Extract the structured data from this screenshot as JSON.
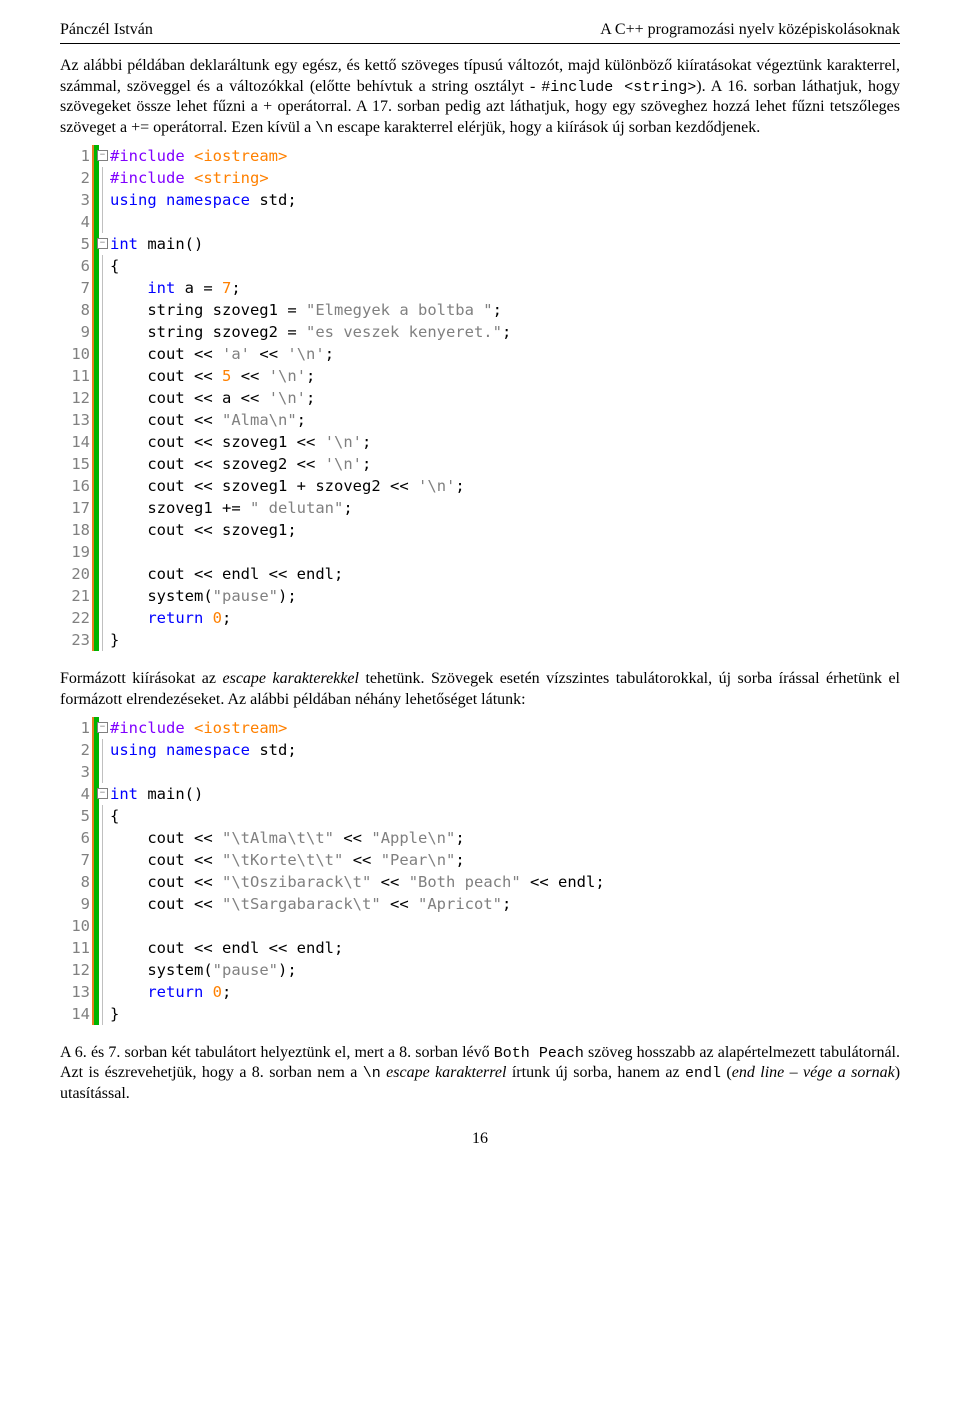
{
  "header": {
    "left": "Pánczél István",
    "right": "A C++ programozási nyelv középiskolásoknak"
  },
  "para1_pre": "Az alábbi példában deklaráltunk egy egész, és kettő szöveges típusú változót, majd különböző kiíratásokat végeztünk karakterrel, számmal, szöveggel és a változókkal (előtte behívtuk a string osztályt - ",
  "para1_code": "#include <string>",
  "para1_post": "). A 16. sorban láthatjuk, hogy szövegeket össze lehet fűzni a + operátorral. A 17. sorban pedig azt láthatjuk, hogy egy szöveghez hozzá lehet fűzni tetszőleges szöveget a += operátorral. Ezen kívül a ",
  "para1_esc": "\\n",
  "para1_end": " escape karakterrel elérjük, hogy a kiírások új sorban kezdődjenek.",
  "code1": [
    {
      "n": "1",
      "fold": "-",
      "og": true,
      "grey": false,
      "parts": [
        [
          "purple",
          "#include "
        ],
        [
          "orange",
          "<iostream>"
        ]
      ]
    },
    {
      "n": "2",
      "fold": "",
      "og": true,
      "grey": true,
      "parts": [
        [
          "purple",
          "#include "
        ],
        [
          "orange",
          "<string>"
        ]
      ]
    },
    {
      "n": "3",
      "fold": "",
      "og": true,
      "grey": true,
      "parts": [
        [
          "blue",
          "using namespace"
        ],
        [
          "black",
          " std"
        ],
        [
          "black",
          ";"
        ]
      ]
    },
    {
      "n": "4",
      "fold": "",
      "og": true,
      "grey": true,
      "parts": [
        [
          "black",
          ""
        ]
      ]
    },
    {
      "n": "5",
      "fold": "-",
      "og": true,
      "grey": false,
      "parts": [
        [
          "blue",
          "int"
        ],
        [
          "black",
          " main"
        ],
        [
          "black",
          "()"
        ]
      ]
    },
    {
      "n": "6",
      "fold": "",
      "og": true,
      "grey": true,
      "parts": [
        [
          "black",
          "{"
        ]
      ]
    },
    {
      "n": "7",
      "fold": "",
      "og": true,
      "grey": true,
      "parts": [
        [
          "black",
          "    "
        ],
        [
          "blue",
          "int"
        ],
        [
          "black",
          " a "
        ],
        [
          "black",
          "="
        ],
        [
          "black",
          " "
        ],
        [
          "orange",
          "7"
        ],
        [
          "black",
          ";"
        ]
      ]
    },
    {
      "n": "8",
      "fold": "",
      "og": true,
      "grey": true,
      "parts": [
        [
          "black",
          "    string szoveg1 "
        ],
        [
          "black",
          "="
        ],
        [
          "black",
          " "
        ],
        [
          "grey",
          "\"Elmegyek a boltba \""
        ],
        [
          "black",
          ";"
        ]
      ]
    },
    {
      "n": "9",
      "fold": "",
      "og": true,
      "grey": true,
      "parts": [
        [
          "black",
          "    string szoveg2 "
        ],
        [
          "black",
          "="
        ],
        [
          "black",
          " "
        ],
        [
          "grey",
          "\"es veszek kenyeret.\""
        ],
        [
          "black",
          ";"
        ]
      ]
    },
    {
      "n": "10",
      "fold": "",
      "og": true,
      "grey": true,
      "parts": [
        [
          "black",
          "    cout "
        ],
        [
          "black",
          "<<"
        ],
        [
          "black",
          " "
        ],
        [
          "grey",
          "'a'"
        ],
        [
          "black",
          " "
        ],
        [
          "black",
          "<<"
        ],
        [
          "black",
          " "
        ],
        [
          "grey",
          "'\\n'"
        ],
        [
          "black",
          ";"
        ]
      ]
    },
    {
      "n": "11",
      "fold": "",
      "og": true,
      "grey": true,
      "parts": [
        [
          "black",
          "    cout "
        ],
        [
          "black",
          "<<"
        ],
        [
          "black",
          " "
        ],
        [
          "orange",
          "5"
        ],
        [
          "black",
          " "
        ],
        [
          "black",
          "<<"
        ],
        [
          "black",
          " "
        ],
        [
          "grey",
          "'\\n'"
        ],
        [
          "black",
          ";"
        ]
      ]
    },
    {
      "n": "12",
      "fold": "",
      "og": true,
      "grey": true,
      "parts": [
        [
          "black",
          "    cout "
        ],
        [
          "black",
          "<<"
        ],
        [
          "black",
          " a "
        ],
        [
          "black",
          "<<"
        ],
        [
          "black",
          " "
        ],
        [
          "grey",
          "'\\n'"
        ],
        [
          "black",
          ";"
        ]
      ]
    },
    {
      "n": "13",
      "fold": "",
      "og": true,
      "grey": true,
      "parts": [
        [
          "black",
          "    cout "
        ],
        [
          "black",
          "<<"
        ],
        [
          "black",
          " "
        ],
        [
          "grey",
          "\"Alma\\n\""
        ],
        [
          "black",
          ";"
        ]
      ]
    },
    {
      "n": "14",
      "fold": "",
      "og": true,
      "grey": true,
      "parts": [
        [
          "black",
          "    cout "
        ],
        [
          "black",
          "<<"
        ],
        [
          "black",
          " szoveg1 "
        ],
        [
          "black",
          "<<"
        ],
        [
          "black",
          " "
        ],
        [
          "grey",
          "'\\n'"
        ],
        [
          "black",
          ";"
        ]
      ]
    },
    {
      "n": "15",
      "fold": "",
      "og": true,
      "grey": true,
      "parts": [
        [
          "black",
          "    cout "
        ],
        [
          "black",
          "<<"
        ],
        [
          "black",
          " szoveg2 "
        ],
        [
          "black",
          "<<"
        ],
        [
          "black",
          " "
        ],
        [
          "grey",
          "'\\n'"
        ],
        [
          "black",
          ";"
        ]
      ]
    },
    {
      "n": "16",
      "fold": "",
      "og": true,
      "grey": true,
      "parts": [
        [
          "black",
          "    cout "
        ],
        [
          "black",
          "<<"
        ],
        [
          "black",
          " szoveg1 "
        ],
        [
          "black",
          "+"
        ],
        [
          "black",
          " szoveg2 "
        ],
        [
          "black",
          "<<"
        ],
        [
          "black",
          " "
        ],
        [
          "grey",
          "'\\n'"
        ],
        [
          "black",
          ";"
        ]
      ]
    },
    {
      "n": "17",
      "fold": "",
      "og": true,
      "grey": true,
      "parts": [
        [
          "black",
          "    szoveg1 "
        ],
        [
          "black",
          "+="
        ],
        [
          "black",
          " "
        ],
        [
          "grey",
          "\" delutan\""
        ],
        [
          "black",
          ";"
        ]
      ]
    },
    {
      "n": "18",
      "fold": "",
      "og": true,
      "grey": true,
      "parts": [
        [
          "black",
          "    cout "
        ],
        [
          "black",
          "<<"
        ],
        [
          "black",
          " szoveg1"
        ],
        [
          "black",
          ";"
        ]
      ]
    },
    {
      "n": "19",
      "fold": "",
      "og": true,
      "grey": true,
      "parts": [
        [
          "black",
          ""
        ]
      ]
    },
    {
      "n": "20",
      "fold": "",
      "og": true,
      "grey": true,
      "parts": [
        [
          "black",
          "    cout "
        ],
        [
          "black",
          "<<"
        ],
        [
          "black",
          " endl "
        ],
        [
          "black",
          "<<"
        ],
        [
          "black",
          " endl"
        ],
        [
          "black",
          ";"
        ]
      ]
    },
    {
      "n": "21",
      "fold": "",
      "og": true,
      "grey": true,
      "parts": [
        [
          "black",
          "    system"
        ],
        [
          "black",
          "("
        ],
        [
          "grey",
          "\"pause\""
        ],
        [
          "black",
          ")"
        ],
        [
          "black",
          ";"
        ]
      ]
    },
    {
      "n": "22",
      "fold": "",
      "og": true,
      "grey": true,
      "parts": [
        [
          "black",
          "    "
        ],
        [
          "blue",
          "return"
        ],
        [
          "black",
          " "
        ],
        [
          "orange",
          "0"
        ],
        [
          "black",
          ";"
        ]
      ]
    },
    {
      "n": "23",
      "fold": "",
      "og": true,
      "grey": true,
      "parts": [
        [
          "black",
          "}"
        ]
      ]
    }
  ],
  "para2_a": "Formázott kiírásokat az ",
  "para2_b": "escape karakterekkel",
  "para2_c": " tehetünk. Szövegek esetén vízszintes tabulátorokkal, új sorba írással érhetünk el formázott elrendezéseket. Az alábbi példában néhány lehetőséget látunk:",
  "code2": [
    {
      "n": "1",
      "fold": "-",
      "og": true,
      "grey": false,
      "parts": [
        [
          "purple",
          "#include "
        ],
        [
          "orange",
          "<iostream>"
        ]
      ]
    },
    {
      "n": "2",
      "fold": "",
      "og": true,
      "grey": true,
      "parts": [
        [
          "blue",
          "using namespace"
        ],
        [
          "black",
          " std"
        ],
        [
          "black",
          ";"
        ]
      ]
    },
    {
      "n": "3",
      "fold": "",
      "og": true,
      "grey": true,
      "parts": [
        [
          "black",
          ""
        ]
      ]
    },
    {
      "n": "4",
      "fold": "-",
      "og": true,
      "grey": false,
      "parts": [
        [
          "blue",
          "int"
        ],
        [
          "black",
          " main"
        ],
        [
          "black",
          "()"
        ]
      ]
    },
    {
      "n": "5",
      "fold": "",
      "og": true,
      "grey": true,
      "parts": [
        [
          "black",
          "{"
        ]
      ]
    },
    {
      "n": "6",
      "fold": "",
      "og": true,
      "grey": true,
      "parts": [
        [
          "black",
          "    cout "
        ],
        [
          "black",
          "<<"
        ],
        [
          "black",
          " "
        ],
        [
          "grey",
          "\"\\tAlma\\t\\t\""
        ],
        [
          "black",
          " "
        ],
        [
          "black",
          "<<"
        ],
        [
          "black",
          " "
        ],
        [
          "grey",
          "\"Apple\\n\""
        ],
        [
          "black",
          ";"
        ]
      ]
    },
    {
      "n": "7",
      "fold": "",
      "og": true,
      "grey": true,
      "parts": [
        [
          "black",
          "    cout "
        ],
        [
          "black",
          "<<"
        ],
        [
          "black",
          " "
        ],
        [
          "grey",
          "\"\\tKorte\\t\\t\""
        ],
        [
          "black",
          " "
        ],
        [
          "black",
          "<<"
        ],
        [
          "black",
          " "
        ],
        [
          "grey",
          "\"Pear\\n\""
        ],
        [
          "black",
          ";"
        ]
      ]
    },
    {
      "n": "8",
      "fold": "",
      "og": true,
      "grey": true,
      "parts": [
        [
          "black",
          "    cout "
        ],
        [
          "black",
          "<<"
        ],
        [
          "black",
          " "
        ],
        [
          "grey",
          "\"\\tOszibarack\\t\""
        ],
        [
          "black",
          " "
        ],
        [
          "black",
          "<<"
        ],
        [
          "black",
          " "
        ],
        [
          "grey",
          "\"Both peach\""
        ],
        [
          "black",
          " "
        ],
        [
          "black",
          "<<"
        ],
        [
          "black",
          " endl"
        ],
        [
          "black",
          ";"
        ]
      ]
    },
    {
      "n": "9",
      "fold": "",
      "og": true,
      "grey": true,
      "parts": [
        [
          "black",
          "    cout "
        ],
        [
          "black",
          "<<"
        ],
        [
          "black",
          " "
        ],
        [
          "grey",
          "\"\\tSargabarack\\t\""
        ],
        [
          "black",
          " "
        ],
        [
          "black",
          "<<"
        ],
        [
          "black",
          " "
        ],
        [
          "grey",
          "\"Apricot\""
        ],
        [
          "black",
          ";"
        ]
      ]
    },
    {
      "n": "10",
      "fold": "",
      "og": true,
      "grey": true,
      "parts": [
        [
          "black",
          ""
        ]
      ]
    },
    {
      "n": "11",
      "fold": "",
      "og": true,
      "grey": true,
      "parts": [
        [
          "black",
          "    cout "
        ],
        [
          "black",
          "<<"
        ],
        [
          "black",
          " endl "
        ],
        [
          "black",
          "<<"
        ],
        [
          "black",
          " endl"
        ],
        [
          "black",
          ";"
        ]
      ]
    },
    {
      "n": "12",
      "fold": "",
      "og": true,
      "grey": true,
      "parts": [
        [
          "black",
          "    system"
        ],
        [
          "black",
          "("
        ],
        [
          "grey",
          "\"pause\""
        ],
        [
          "black",
          ")"
        ],
        [
          "black",
          ";"
        ]
      ]
    },
    {
      "n": "13",
      "fold": "",
      "og": true,
      "grey": true,
      "parts": [
        [
          "black",
          "    "
        ],
        [
          "blue",
          "return"
        ],
        [
          "black",
          " "
        ],
        [
          "orange",
          "0"
        ],
        [
          "black",
          ";"
        ]
      ]
    },
    {
      "n": "14",
      "fold": "",
      "og": true,
      "grey": true,
      "parts": [
        [
          "black",
          "}"
        ]
      ]
    }
  ],
  "para3_a": "A 6. és 7. sorban két tabulátort helyeztünk el, mert a 8. sorban lévő ",
  "para3_code": "Both Peach",
  "para3_b": " szöveg hosszabb az alapértelmezett tabulátornál. Azt is észrevehetjük, hogy a 8. sorban nem a ",
  "para3_esc": "\\n",
  "para3_c": " ",
  "para3_it1": "escape karakterrel",
  "para3_d": " írtunk új sorba, hanem az ",
  "para3_code2": "endl",
  "para3_e": " (",
  "para3_it2": "end line – vége a sornak",
  "para3_f": ") utasítással.",
  "page_number": "16"
}
